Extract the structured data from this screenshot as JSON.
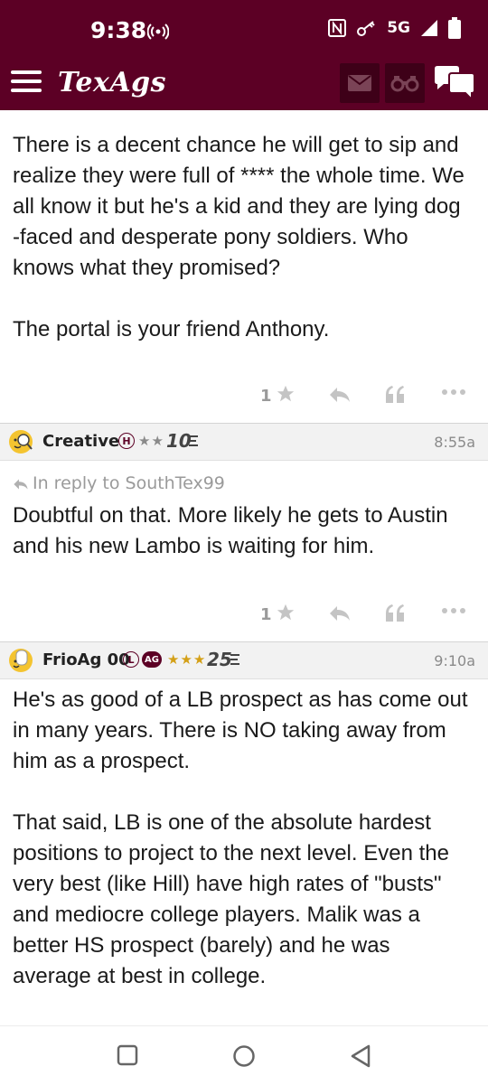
{
  "status_bar": {
    "time": "9:38",
    "network": "5G",
    "icons": [
      "radio-icon",
      "nfc-icon",
      "key-icon",
      "signal-icon",
      "battery-icon"
    ]
  },
  "header": {
    "logo": "TexAgs",
    "icons": [
      "hamburger-menu-icon",
      "mail-icon",
      "binoculars-icon",
      "chat-icon"
    ]
  },
  "colors": {
    "brand": "#5c0025",
    "brand_dark": "#3e0018",
    "muted": "#9a9a9a",
    "gold": "#d4a017"
  },
  "posts": [
    {
      "paragraphs": [
        "There is a decent chance he will get to sip and realize they were full of **** the whole time. We all know it but he's a kid and they are lying dog -faced and desperate pony soldiers. Who knows what they promised?",
        "The portal is your friend Anthony."
      ],
      "likes": "1"
    },
    {
      "username": "Creative",
      "badge": "H",
      "stars": "★★",
      "rank": "10",
      "time": "8:55a",
      "reply_to": "In reply to SouthTex99",
      "paragraphs": [
        "Doubtful on that. More likely he gets to Austin and his new Lambo is waiting for him."
      ],
      "likes": "1"
    },
    {
      "username": "FrioAg 00",
      "badge": "L",
      "badge2": "AG",
      "stars": "★★★",
      "rank": "25",
      "time": "9:10a",
      "paragraphs": [
        "He's as good of a LB prospect as has come out in many years. There is NO taking away from him as a prospect.",
        "That said, LB is one of the absolute hardest positions to project to the next level. Even the very best (like Hill) have high rates of \"busts\" and mediocre college players. Malik was a better HS prospect (barely) and he was average at best in college."
      ]
    }
  ],
  "nav_bar": {
    "icons": [
      "recents-square-icon",
      "home-circle-icon",
      "back-triangle-icon"
    ]
  }
}
